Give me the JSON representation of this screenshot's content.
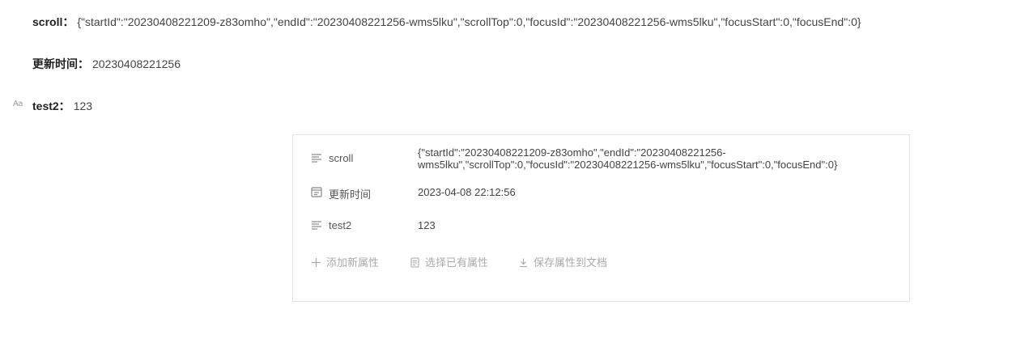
{
  "doc_attrs": {
    "scroll": {
      "label": "scroll：",
      "value": "{\"startId\":\"20230408221209-z83omho\",\"endId\":\"20230408221256-wms5lku\",\"scrollTop\":0,\"focusId\":\"20230408221256-wms5lku\",\"focusStart\":0,\"focusEnd\":0}"
    },
    "updated": {
      "label": "更新时间：",
      "value": "20230408221256"
    },
    "test2": {
      "label": "test2：",
      "value": "123",
      "icon_text": "Aa"
    }
  },
  "panel": {
    "rows": [
      {
        "icon": "text-lines-icon",
        "label": "scroll",
        "value_line1": "{\"startId\":\"20230408221209-z83omho\",\"endId\":\"20230408221256-",
        "value_line2": "wms5lku\",\"scrollTop\":0,\"focusId\":\"20230408221256-wms5lku\",\"focusStart\":0,\"focusEnd\":0}"
      },
      {
        "icon": "calendar-icon",
        "label": "更新时间",
        "value": "2023-04-08 22:12:56"
      },
      {
        "icon": "text-lines-icon",
        "label": "test2",
        "value": "123"
      }
    ],
    "actions": {
      "add": {
        "icon": "plus-icon",
        "label": "添加新属性"
      },
      "select": {
        "icon": "document-icon",
        "label": "选择已有属性"
      },
      "save": {
        "icon": "download-icon",
        "label": "保存属性到文档"
      }
    }
  }
}
